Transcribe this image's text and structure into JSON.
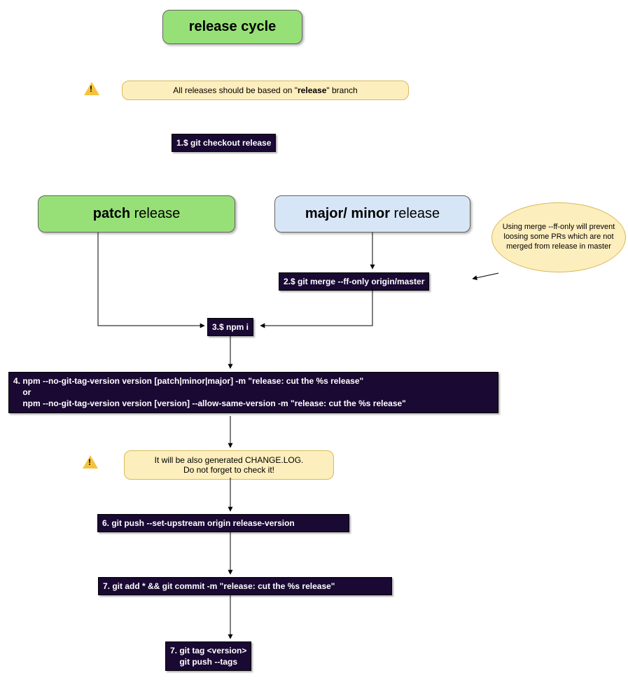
{
  "title": "release cycle",
  "note_top_prefix": "All releases should be based on \"",
  "note_top_bold": "release",
  "note_top_suffix": "\" branch",
  "step1": "1.$ git checkout release",
  "patch_bold": "patch",
  "patch_rest": " release",
  "major_bold": "major/ minor",
  "major_rest": " release",
  "ellipse_note": "Using merge --ff-only will prevent loosing some PRs which are not merged from release in master",
  "step2": "2.$ git merge --ff-only origin/master",
  "step3": "3.$ npm i",
  "step4": "4. npm --no-git-tag-version version [patch|minor|major] -m \"release: cut the %s release\"\n    or\n    npm --no-git-tag-version version [version] --allow-same-version -m \"release: cut the %s release\"",
  "note_mid_line1": "It will be also generated CHANGE.LOG.",
  "note_mid_line2": "Do not forget to check it!",
  "step6": "6. git push --set-upstream origin release-version",
  "step7a": "7. git add * && git commit -m \"release: cut the %s release\"",
  "step7b": "7. git tag <version>\n    git push --tags"
}
